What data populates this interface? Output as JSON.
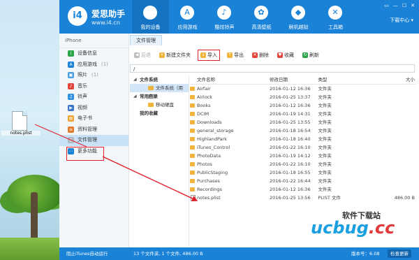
{
  "desktop": {
    "file_label": "notes.plist"
  },
  "brand": {
    "name": "爱思助手",
    "url": "www.i4.cn",
    "logo": "i4"
  },
  "window": {
    "min": "▭",
    "menu": "—",
    "max": "☐",
    "close": "✕",
    "download_center": "下载中心 ▾"
  },
  "nav": [
    {
      "label": "我的设备",
      "icon": "apple-icon",
      "glyph": "",
      "active": true
    },
    {
      "label": "应用游戏",
      "icon": "appstore-icon",
      "glyph": "A"
    },
    {
      "label": "酷炫铃声",
      "icon": "bell-icon",
      "glyph": "♪"
    },
    {
      "label": "高清壁纸",
      "icon": "flower-icon",
      "glyph": "✿"
    },
    {
      "label": "刷机越狱",
      "icon": "box-icon",
      "glyph": "◆"
    },
    {
      "label": "工具箱",
      "icon": "tools-icon",
      "glyph": "✕"
    }
  ],
  "device": {
    "name": "iPhone"
  },
  "sidebar": [
    {
      "label": "设备信息",
      "count": "",
      "color": "#2ca44a",
      "glyph": "i"
    },
    {
      "label": "应用游戏",
      "count": "(1)",
      "color": "#1a83d7",
      "glyph": "A"
    },
    {
      "label": "照片",
      "count": "(1)",
      "color": "#4aa0e0",
      "glyph": "▣"
    },
    {
      "label": "音乐",
      "count": "",
      "color": "#e2463c",
      "glyph": "♪"
    },
    {
      "label": "铃声",
      "count": "",
      "color": "#2f8fe0",
      "glyph": "♫"
    },
    {
      "label": "视频",
      "count": "",
      "color": "#3b78c8",
      "glyph": "▶"
    },
    {
      "label": "电子书",
      "count": "",
      "color": "#f0a030",
      "glyph": "▤"
    },
    {
      "label": "资料管理",
      "count": "",
      "color": "#e07a2c",
      "glyph": "≡"
    },
    {
      "label": "文件管理",
      "count": "",
      "color": "#b0b8c0",
      "glyph": "▯",
      "active": true
    },
    {
      "label": "更多功能",
      "count": "",
      "color": "#1a83d7",
      "glyph": "⋯"
    }
  ],
  "tab": {
    "label": "文件管理"
  },
  "toolbar": [
    {
      "label": "后退",
      "color": "#bbb",
      "glyph": "◀",
      "disabled": true
    },
    {
      "label": "新建文件夹",
      "color": "#f0b43c",
      "glyph": "+"
    },
    {
      "label": "导入",
      "color": "#f0b43c",
      "glyph": "↓",
      "highlight": true
    },
    {
      "label": "导出",
      "color": "#f0b43c",
      "glyph": "↑"
    },
    {
      "label": "删除",
      "color": "#e2463c",
      "glyph": "✕"
    },
    {
      "label": "收藏",
      "color": "#e2463c",
      "glyph": "♥"
    },
    {
      "label": "刷新",
      "color": "#2ca44a",
      "glyph": "↻"
    }
  ],
  "path": "/",
  "tree": [
    {
      "label": "文件系统",
      "level": 0,
      "arrow": "◢"
    },
    {
      "label": "文件系统（用户）",
      "level": 1,
      "selected": true
    },
    {
      "label": "常用目录",
      "level": 0,
      "arrow": "◢"
    },
    {
      "label": "移动硬盘",
      "level": 1
    },
    {
      "label": "我的收藏",
      "level": 0,
      "arrow": ""
    }
  ],
  "table": {
    "headers": {
      "name": "文件名称",
      "date": "修改日期",
      "type": "类型",
      "size": "大小"
    },
    "rows": [
      {
        "name": "Airfair",
        "date": "2016-01-12 16:36",
        "type": "文件夹",
        "size": "",
        "kind": "folder"
      },
      {
        "name": "Airlock",
        "date": "2016-01-25 13:37",
        "type": "文件夹",
        "size": "",
        "kind": "folder"
      },
      {
        "name": "Books",
        "date": "2016-01-12 16:36",
        "type": "文件夹",
        "size": "",
        "kind": "folder"
      },
      {
        "name": "DCIM",
        "date": "2016-01-19 14:31",
        "type": "文件夹",
        "size": "",
        "kind": "folder"
      },
      {
        "name": "Downloads",
        "date": "2016-01-25 13:55",
        "type": "文件夹",
        "size": "",
        "kind": "folder"
      },
      {
        "name": "general_storage",
        "date": "2016-01-18 16:54",
        "type": "文件夹",
        "size": "",
        "kind": "folder"
      },
      {
        "name": "HighlandPark",
        "date": "2016-01-18 16:40",
        "type": "文件夹",
        "size": "",
        "kind": "folder"
      },
      {
        "name": "iTunes_Control",
        "date": "2016-01-22 16:10",
        "type": "文件夹",
        "size": "",
        "kind": "folder"
      },
      {
        "name": "PhotoData",
        "date": "2016-01-19 14:12",
        "type": "文件夹",
        "size": "",
        "kind": "folder"
      },
      {
        "name": "Photos",
        "date": "2016-01-22 16:10",
        "type": "文件夹",
        "size": "",
        "kind": "folder"
      },
      {
        "name": "PublicStaging",
        "date": "2016-01-18 16:55",
        "type": "文件夹",
        "size": "",
        "kind": "folder"
      },
      {
        "name": "Purchases",
        "date": "2016-01-22 16:44",
        "type": "文件夹",
        "size": "",
        "kind": "folder"
      },
      {
        "name": "Recordings",
        "date": "2016-01-12 16:36",
        "type": "文件夹",
        "size": "",
        "kind": "folder"
      },
      {
        "name": "notes.plist",
        "date": "2016-01-25 13:56",
        "type": "PLIST 文件",
        "size": "486.00 B",
        "kind": "file"
      }
    ]
  },
  "status": {
    "itunes": "阻止iTunes自动运行",
    "summary": "13 个文件夹, 1 个文件, 486.00 B",
    "version": "版本号：6.08",
    "update": "检查更新"
  },
  "watermark": {
    "cn": "软件下载站",
    "en_main": "ucbug",
    "en_tld": ".cc"
  },
  "colors": {
    "brand_blue": "#1a83d7",
    "highlight_red": "#e0202a"
  }
}
